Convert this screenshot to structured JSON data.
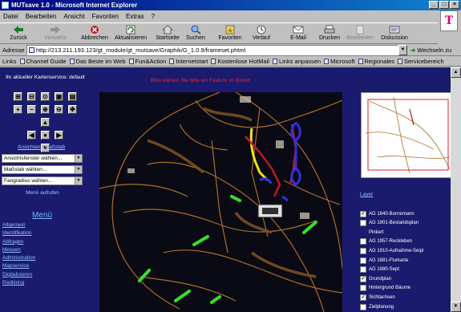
{
  "window": {
    "title": "MUTsave 1.0 - Microsoft Internet Explorer",
    "controls": [
      "_",
      "□",
      "×"
    ]
  },
  "menubar": [
    "Datei",
    "Bearbeiten",
    "Ansicht",
    "Favoriten",
    "Extras",
    "?"
  ],
  "brand_logo": "T",
  "toolbar": {
    "back": "Zurück",
    "forward": "Vorwärts",
    "stop": "Abbrechen",
    "refresh": "Aktualisieren",
    "home": "Startseite",
    "search": "Suchen",
    "favorites": "Favoriten",
    "history": "Verlauf",
    "mail": "E-Mail",
    "print": "Drucken",
    "edit": "Bearbeiten",
    "discuss": "Diskussion"
  },
  "address": {
    "label": "Adresse",
    "url": "http://213.211.193.123/gt_module/gt_mutsave/Graphik/G_1.0.9/frameset.phtml",
    "go": "Wechseln zu"
  },
  "links": {
    "label": "Links",
    "items": [
      "Channel Guide",
      "Das Beste im Web",
      "Fun&Action",
      "Internetstart",
      "Kostenlose HotMail",
      "Links anpassen",
      "Microsoft",
      "Regionales",
      "Servicebereich"
    ]
  },
  "page": {
    "map_name": "Ihr aktueller Kartenservice: default",
    "notice": "Bitte wählen Sie bitte ein Feature im Boxen",
    "views_link": "Ansichten / Maßstab",
    "selects": [
      "Ansichtsfenster wählen...",
      "Maßstab wählen...",
      "Fangradius wählen..."
    ],
    "menu_toggle": "Menü aufrufen",
    "menu_title": "Menü",
    "menu_items": [
      "Allgemein",
      "Identifikation",
      "Abfragen",
      "Messen",
      "Administration",
      "Mapservice",
      "Digitalisieren",
      "Redlining"
    ],
    "layer_heading": "Layer",
    "layers": [
      {
        "label": "AG 1840-Bornemann",
        "checked": true
      },
      {
        "label": "AG 1901-Bestandsplan",
        "checked": false
      },
      {
        "label": "Pinkert",
        "checked": false
      },
      {
        "label": "AG 1957-Reckleben",
        "checked": false
      },
      {
        "label": "AG 1910-Aufnahme-Seipl",
        "checked": false
      },
      {
        "label": "AG 1881-Flurkarte",
        "checked": false
      },
      {
        "label": "AG 1980-Sept",
        "checked": false
      },
      {
        "label": "Grundplan",
        "checked": true
      },
      {
        "label": "Hintergrund Bäume",
        "checked": false
      },
      {
        "label": "Sichtachsen",
        "checked": true
      },
      {
        "label": "Zielplanung",
        "checked": false
      }
    ]
  },
  "colors": {
    "title_bar": "#000080",
    "page_bg": "#1a1a6e",
    "link": "#8fc0ff",
    "notice": "#ff1a1a",
    "map_brown": "#a86e2b",
    "map_yellow": "#f0e020",
    "map_green": "#38e028",
    "map_blue": "#3030e0",
    "map_red": "#c01828",
    "brand": "#e20074"
  }
}
